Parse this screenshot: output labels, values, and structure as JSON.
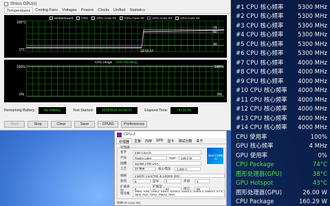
{
  "stability": {
    "stress_gpu_label": "Stress GPU(s)",
    "tabs": [
      "Temperatures",
      "Cooling Fans",
      "Voltages",
      "Powers",
      "Clocks",
      "Unified",
      "Statistics"
    ],
    "graph1": {
      "legend": [
        "Motherboard",
        "CPU",
        "CPU Core #1",
        "CPU Core #2",
        "CPU Core #3",
        "CPU Core #4"
      ],
      "y_top": "100°C",
      "y_bottom": "0°C",
      "time": "16:56:07",
      "right_values": [
        "74",
        "80",
        "40"
      ]
    },
    "graph2": {
      "legend": [
        "CPU Usage",
        "CPU Throttling"
      ],
      "y_top": "100%",
      "y_bottom": "0%",
      "right_top": "100%",
      "right_bottom": "0%"
    },
    "status": {
      "remaining_battery_label": "Remaining Battery:",
      "remaining_battery_value": "No battery",
      "test_started_label": "Test Started:",
      "test_started_value": "2023/9/14 16:56:07",
      "elapsed_label": "Elapsed Time:",
      "elapsed_value": "00:10:00"
    },
    "buttons": [
      "Start",
      "Stop",
      "Clear",
      "Save",
      "CPUID",
      "Preferences"
    ]
  },
  "cpuz": {
    "title": "CPU-Z",
    "tabs": [
      "处理器",
      "主板",
      "内存",
      "SPD",
      "显卡",
      "测试分数",
      "关于"
    ],
    "group_processor": "处理器",
    "name_label": "名字",
    "name_value": "Intel Core i5",
    "code_label": "代号",
    "code_value": "Raptor Lake",
    "tdp_label": "TDP",
    "tdp_value": "125.0 W",
    "package_label": "插槽",
    "package_value": "Socket 1700 LGA",
    "tech_label": "工艺",
    "tech_value": "10 纳米",
    "voltage_label": "核心电压",
    "voltage_value": "1.200 V",
    "spec_label": "规格",
    "spec_value": "Intel(R) Core(TM) i5-14600K (ES)",
    "family_label": "系列",
    "family_value": "6",
    "model_label": "型号",
    "model_value": "7",
    "stepping_label": "步进",
    "stepping_value": "1",
    "ext_family_label": "扩展系列",
    "ext_family_value": "6",
    "ext_model_label": "扩展型号",
    "ext_model_value": "B7",
    "revision_label": "修订",
    "revision_value": "B0",
    "instr_label": "指令集",
    "instr_value": "MMX, SSE, SSE2, SSE3, SSSE3, SSE4.1, SSE4.2, EM64T, VT-x, AES, AVX, AVX2, FMA3, SHA",
    "intel_badge": "intel CORE i5",
    "footer": "时钟 (P-Core #0)"
  },
  "osd": [
    {
      "label": "#1 CPU 核心频率",
      "value": "5300 MHz",
      "color": "white"
    },
    {
      "label": "#2 CPU 核心频率",
      "value": "5300 MHz",
      "color": "white"
    },
    {
      "label": "#3 CPU 核心频率",
      "value": "5300 MHz",
      "color": "white"
    },
    {
      "label": "#4 CPU 核心频率",
      "value": "5300 MHz",
      "color": "white"
    },
    {
      "label": "#5 CPU 核心频率",
      "value": "5300 MHz",
      "color": "white"
    },
    {
      "label": "#6 CPU 核心频率",
      "value": "5300 MHz",
      "color": "white"
    },
    {
      "label": "#7 CPU 核心频率",
      "value": "4000 MHz",
      "color": "white"
    },
    {
      "label": "#8 CPU 核心频率",
      "value": "4000 MHz",
      "color": "white"
    },
    {
      "label": "#9 CPU 核心频率",
      "value": "4000 MHz",
      "color": "white"
    },
    {
      "label": "#10 CPU 核心频率",
      "value": "4000 MHz",
      "color": "white"
    },
    {
      "label": "#11 CPU 核心频率",
      "value": "4000 MHz",
      "color": "white"
    },
    {
      "label": "#12 CPU 核心频率",
      "value": "4000 MHz",
      "color": "white"
    },
    {
      "label": "#13 CPU 核心频率",
      "value": "4000 MHz",
      "color": "white"
    },
    {
      "label": "#14 CPU 核心频率",
      "value": "4000 MHz",
      "color": "white"
    },
    {
      "label": "CPU 使用率",
      "value": "100%",
      "color": "white"
    },
    {
      "label": "GPU 核心频率",
      "value": "4 MHz",
      "color": "white"
    },
    {
      "label": "GPU 使用率",
      "value": "0%",
      "color": "white"
    },
    {
      "label": "CPU Package",
      "value": "74°C",
      "color": "green"
    },
    {
      "label": "图形处理器(GPU)",
      "value": "38°C",
      "color": "green"
    },
    {
      "label": "GPU Hotspot",
      "value": "43°C",
      "color": "green"
    },
    {
      "label": "图形处理器(GPU)",
      "value": "26.00 W",
      "color": "white"
    },
    {
      "label": "CPU Package",
      "value": "160.29 W",
      "color": "white"
    }
  ]
}
